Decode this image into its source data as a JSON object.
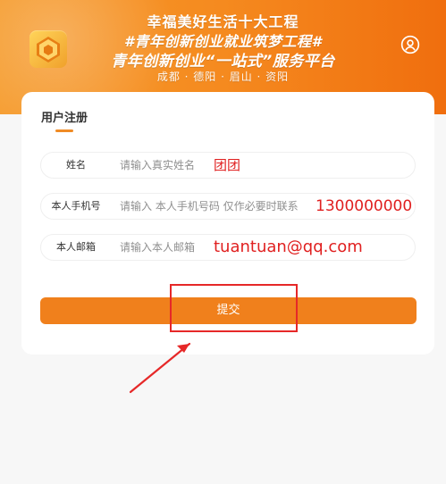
{
  "header": {
    "line1": "幸福美好生活十大工程",
    "line2": "#青年创新创业就业筑梦工程#",
    "line3": "青年创新创业“一站式”服务平台",
    "cities": "成都 · 德阳 · 眉山 · 资阳"
  },
  "form": {
    "title": "用户注册",
    "fields": [
      {
        "label": "姓名",
        "placeholder": "请输入真实姓名",
        "value": "团团"
      },
      {
        "label": "本人手机号",
        "placeholder": "请输入 本人手机号码 仅作必要时联系",
        "value": "1300000000"
      },
      {
        "label": "本人邮箱",
        "placeholder": "请输入本人邮箱",
        "value": "tuantuan@qq.com"
      }
    ],
    "submit_label": "提交"
  },
  "colors": {
    "header_start": "#f59a2a",
    "header_end": "#f06e0e",
    "submit": "#f0801c",
    "annotation": "#e62828"
  },
  "icons": {
    "logo": "logo-icon",
    "user": "user-icon",
    "arrow": "arrow-icon"
  }
}
